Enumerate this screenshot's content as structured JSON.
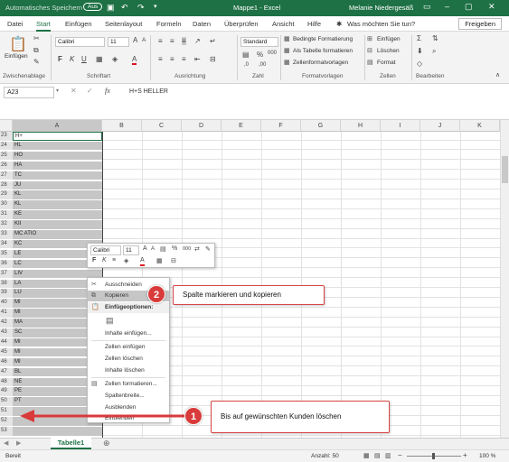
{
  "titlebar": {
    "autosave": "Automatisches Speichern",
    "autosave_state": "Aus",
    "doc_title": "Mappe1 - Excel",
    "user": "Melanie Niedergesäß"
  },
  "tabs": [
    "Datei",
    "Start",
    "Einfügen",
    "Seitenlayout",
    "Formeln",
    "Daten",
    "Überprüfen",
    "Ansicht",
    "Hilfe"
  ],
  "search_placeholder": "Was möchten Sie tun?",
  "share_label": "Freigeben",
  "ribbon": {
    "paste_label": "Einfügen",
    "font_name": "Calibri",
    "font_size": "11",
    "number_format": "Standard",
    "cond_format": "Bedingte Formatierung",
    "as_table": "Als Tabelle formatieren",
    "cell_styles": "Zellenformatvorlagen",
    "cells_insert": "Einfügen",
    "cells_delete": "Löschen",
    "cells_format": "Format",
    "groups": {
      "clipboard": "Zwischenablage",
      "font": "Schriftart",
      "alignment": "Ausrichtung",
      "number": "Zahl",
      "styles": "Formatvorlagen",
      "cells": "Zellen",
      "editing": "Bearbeiten"
    }
  },
  "formula_bar": {
    "cell_ref": "A23",
    "formula": "H+S HELLER"
  },
  "columns": [
    "A",
    "B",
    "C",
    "D",
    "E",
    "F",
    "G",
    "H",
    "I",
    "J",
    "K"
  ],
  "rows": [
    {
      "n": "23",
      "a": "H+"
    },
    {
      "n": "24",
      "a": "HL"
    },
    {
      "n": "25",
      "a": "HO"
    },
    {
      "n": "26",
      "a": "HA"
    },
    {
      "n": "27",
      "a": "TC"
    },
    {
      "n": "28",
      "a": "JU"
    },
    {
      "n": "29",
      "a": "KL"
    },
    {
      "n": "30",
      "a": "KL"
    },
    {
      "n": "31",
      "a": "KE"
    },
    {
      "n": "32",
      "a": "KII"
    },
    {
      "n": "33",
      "a": "MC                         ATIO"
    },
    {
      "n": "34",
      "a": "KC"
    },
    {
      "n": "35",
      "a": "LE"
    },
    {
      "n": "36",
      "a": "LC"
    },
    {
      "n": "37",
      "a": "LIV"
    },
    {
      "n": "38",
      "a": "LA"
    },
    {
      "n": "39",
      "a": "LU"
    },
    {
      "n": "40",
      "a": "MI"
    },
    {
      "n": "41",
      "a": "MI"
    },
    {
      "n": "42",
      "a": "MA"
    },
    {
      "n": "43",
      "a": "SC"
    },
    {
      "n": "44",
      "a": "MI"
    },
    {
      "n": "45",
      "a": "MI"
    },
    {
      "n": "46",
      "a": "MI"
    },
    {
      "n": "47",
      "a": "BL"
    },
    {
      "n": "48",
      "a": "NE"
    },
    {
      "n": "49",
      "a": "PE"
    },
    {
      "n": "50",
      "a": "PT"
    },
    {
      "n": "51",
      "a": ""
    },
    {
      "n": "52",
      "a": ""
    },
    {
      "n": "53",
      "a": ""
    }
  ],
  "mini_toolbar": {
    "font": "Calibri",
    "size": "11"
  },
  "context_menu": [
    {
      "label": "Ausschneiden",
      "icon": "scissors-icon"
    },
    {
      "label": "Kopieren",
      "icon": "copy-icon"
    },
    {
      "label": "Einfügeoptionen:",
      "icon": "paste-icon"
    },
    {
      "label": "",
      "icon": "paste-option-icon"
    },
    {
      "label": "Inhalte einfügen...",
      "icon": ""
    },
    {
      "label": "Zellen einfügen",
      "icon": ""
    },
    {
      "label": "Zellen löschen",
      "icon": ""
    },
    {
      "label": "Inhalte löschen",
      "icon": ""
    },
    {
      "label": "Zellen formatieren...",
      "icon": "format-cells-icon"
    },
    {
      "label": "Spaltenbreite...",
      "icon": ""
    },
    {
      "label": "Ausblenden",
      "icon": ""
    },
    {
      "label": "Einblenden",
      "icon": ""
    }
  ],
  "callouts": {
    "one_number": "1",
    "one_text": "Bis auf gewünschten Kunden löschen",
    "two_number": "2",
    "two_text": "Spalte markieren und kopieren"
  },
  "sheet_tab": "Tabelle1",
  "status": {
    "ready": "Bereit",
    "count": "Anzahl: 50",
    "zoom": "100 %"
  },
  "colors": {
    "excel_green": "#1e7145",
    "callout_red": "#d93a3a",
    "selection_gray": "#c6c6c6"
  }
}
